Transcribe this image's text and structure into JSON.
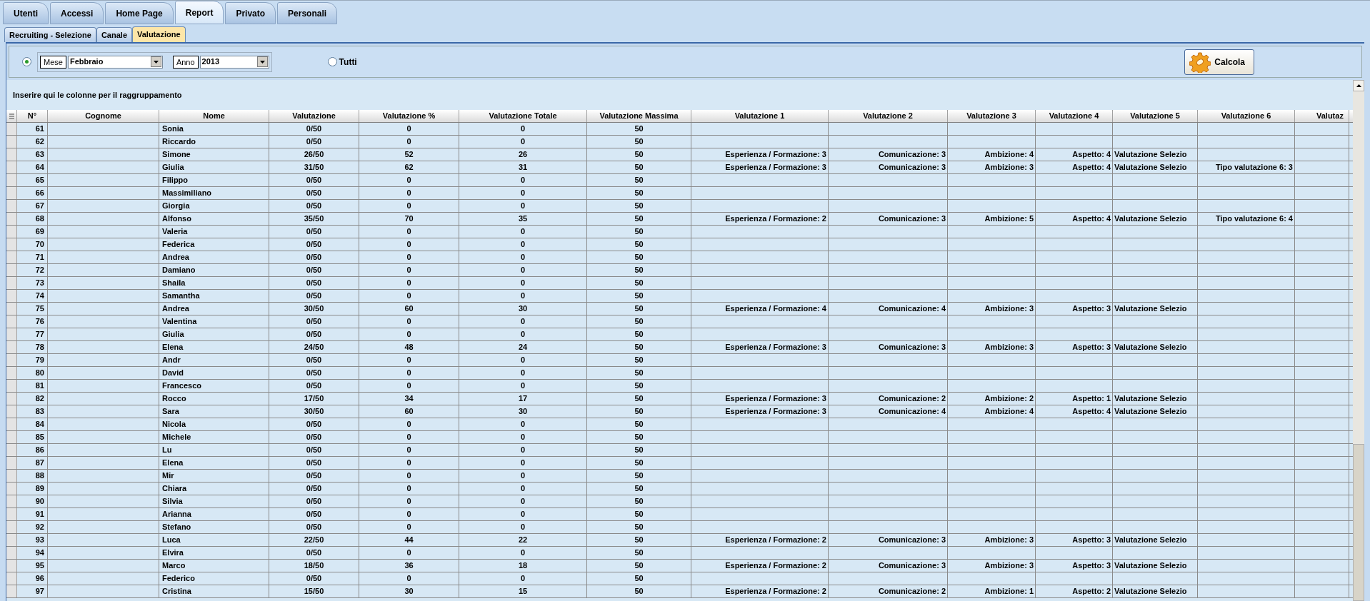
{
  "tabs": [
    {
      "label": "Utenti",
      "selected": false
    },
    {
      "label": "Accessi",
      "selected": false
    },
    {
      "label": "Home Page",
      "selected": false
    },
    {
      "label": "Report",
      "selected": true
    },
    {
      "label": "Privato",
      "selected": false
    },
    {
      "label": "Personali",
      "selected": false
    }
  ],
  "subtabs": [
    {
      "label": "Recruiting - Selezione",
      "selected": false
    },
    {
      "label": "Canale",
      "selected": false
    },
    {
      "label": "Valutazione",
      "selected": true
    }
  ],
  "filter": {
    "month_radio": {
      "selected": true
    },
    "month": {
      "label": "Mese",
      "value": "Febbraio"
    },
    "year": {
      "label": "Anno",
      "value": "2013"
    },
    "all_radio": {
      "label": "Tutti",
      "selected": false
    },
    "calculate_button": "Calcola"
  },
  "group_hint": "Inserire qui le colonne per il raggruppamento",
  "table": {
    "columns": [
      "N°",
      "Cognome",
      "Nome",
      "Valutazione",
      "Valutazione %",
      "Valutazione Totale",
      "Valutazione Massima",
      "Valutazione 1",
      "Valutazione 2",
      "Valutazione 3",
      "Valutazione 4",
      "Valutazione 5",
      "Valutazione 6",
      "Valutaz"
    ],
    "rows": [
      {
        "n": "61",
        "nome": "Sonia",
        "val": "0/50",
        "pct": "0",
        "tot": "0",
        "max": "50"
      },
      {
        "n": "62",
        "nome": "Riccardo",
        "val": "0/50",
        "pct": "0",
        "tot": "0",
        "max": "50"
      },
      {
        "n": "63",
        "nome": "Simone",
        "val": "26/50",
        "pct": "52",
        "tot": "26",
        "max": "50",
        "v1": "Esperienza / Formazione: 3",
        "v2": "Comunicazione: 3",
        "v3": "Ambizione: 4",
        "v4": "Aspetto: 4",
        "v5": "Valutazione Selezio"
      },
      {
        "n": "64",
        "nome": "Giulia",
        "val": "31/50",
        "pct": "62",
        "tot": "31",
        "max": "50",
        "v1": "Esperienza / Formazione: 3",
        "v2": "Comunicazione: 3",
        "v3": "Ambizione: 3",
        "v4": "Aspetto: 4",
        "v5": "Valutazione Selezio",
        "v6": "Tipo valutazione 6: 3"
      },
      {
        "n": "65",
        "nome": "Filippo",
        "val": "0/50",
        "pct": "0",
        "tot": "0",
        "max": "50"
      },
      {
        "n": "66",
        "nome": "Massimiliano",
        "val": "0/50",
        "pct": "0",
        "tot": "0",
        "max": "50"
      },
      {
        "n": "67",
        "nome": "Giorgia",
        "val": "0/50",
        "pct": "0",
        "tot": "0",
        "max": "50"
      },
      {
        "n": "68",
        "nome": "Alfonso",
        "val": "35/50",
        "pct": "70",
        "tot": "35",
        "max": "50",
        "v1": "Esperienza / Formazione: 2",
        "v2": "Comunicazione: 3",
        "v3": "Ambizione: 5",
        "v4": "Aspetto: 4",
        "v5": "Valutazione Selezio",
        "v6": "Tipo valutazione 6: 4"
      },
      {
        "n": "69",
        "nome": "Valeria",
        "val": "0/50",
        "pct": "0",
        "tot": "0",
        "max": "50"
      },
      {
        "n": "70",
        "nome": "Federica",
        "val": "0/50",
        "pct": "0",
        "tot": "0",
        "max": "50"
      },
      {
        "n": "71",
        "nome": "Andrea",
        "val": "0/50",
        "pct": "0",
        "tot": "0",
        "max": "50"
      },
      {
        "n": "72",
        "nome": "Damiano",
        "val": "0/50",
        "pct": "0",
        "tot": "0",
        "max": "50"
      },
      {
        "n": "73",
        "nome": "Shaila",
        "val": "0/50",
        "pct": "0",
        "tot": "0",
        "max": "50"
      },
      {
        "n": "74",
        "nome": "Samantha",
        "val": "0/50",
        "pct": "0",
        "tot": "0",
        "max": "50"
      },
      {
        "n": "75",
        "nome": "Andrea",
        "val": "30/50",
        "pct": "60",
        "tot": "30",
        "max": "50",
        "v1": "Esperienza / Formazione: 4",
        "v2": "Comunicazione: 4",
        "v3": "Ambizione: 3",
        "v4": "Aspetto: 3",
        "v5": "Valutazione Selezio"
      },
      {
        "n": "76",
        "nome": "Valentina",
        "val": "0/50",
        "pct": "0",
        "tot": "0",
        "max": "50"
      },
      {
        "n": "77",
        "nome": "Giulia",
        "val": "0/50",
        "pct": "0",
        "tot": "0",
        "max": "50"
      },
      {
        "n": "78",
        "nome": "Elena",
        "val": "24/50",
        "pct": "48",
        "tot": "24",
        "max": "50",
        "v1": "Esperienza / Formazione: 3",
        "v2": "Comunicazione: 3",
        "v3": "Ambizione: 3",
        "v4": "Aspetto: 3",
        "v5": "Valutazione Selezio"
      },
      {
        "n": "79",
        "nome": "Andr",
        "val": "0/50",
        "pct": "0",
        "tot": "0",
        "max": "50"
      },
      {
        "n": "80",
        "nome": "David",
        "val": "0/50",
        "pct": "0",
        "tot": "0",
        "max": "50"
      },
      {
        "n": "81",
        "nome": "Francesco",
        "val": "0/50",
        "pct": "0",
        "tot": "0",
        "max": "50"
      },
      {
        "n": "82",
        "nome": "Rocco",
        "val": "17/50",
        "pct": "34",
        "tot": "17",
        "max": "50",
        "v1": "Esperienza / Formazione: 3",
        "v2": "Comunicazione: 2",
        "v3": "Ambizione: 2",
        "v4": "Aspetto: 1",
        "v5": "Valutazione Selezio"
      },
      {
        "n": "83",
        "nome": "Sara",
        "val": "30/50",
        "pct": "60",
        "tot": "30",
        "max": "50",
        "v1": "Esperienza / Formazione: 3",
        "v2": "Comunicazione: 4",
        "v3": "Ambizione: 4",
        "v4": "Aspetto: 4",
        "v5": "Valutazione Selezio"
      },
      {
        "n": "84",
        "nome": "Nicola",
        "val": "0/50",
        "pct": "0",
        "tot": "0",
        "max": "50"
      },
      {
        "n": "85",
        "nome": "Michele",
        "val": "0/50",
        "pct": "0",
        "tot": "0",
        "max": "50"
      },
      {
        "n": "86",
        "nome": "Lu",
        "val": "0/50",
        "pct": "0",
        "tot": "0",
        "max": "50"
      },
      {
        "n": "87",
        "nome": "Elena",
        "val": "0/50",
        "pct": "0",
        "tot": "0",
        "max": "50"
      },
      {
        "n": "88",
        "nome": "Mir",
        "val": "0/50",
        "pct": "0",
        "tot": "0",
        "max": "50"
      },
      {
        "n": "89",
        "nome": "Chiara",
        "val": "0/50",
        "pct": "0",
        "tot": "0",
        "max": "50"
      },
      {
        "n": "90",
        "nome": "Silvia",
        "val": "0/50",
        "pct": "0",
        "tot": "0",
        "max": "50"
      },
      {
        "n": "91",
        "nome": "Arianna",
        "val": "0/50",
        "pct": "0",
        "tot": "0",
        "max": "50"
      },
      {
        "n": "92",
        "nome": "Stefano",
        "val": "0/50",
        "pct": "0",
        "tot": "0",
        "max": "50"
      },
      {
        "n": "93",
        "nome": "Luca",
        "val": "22/50",
        "pct": "44",
        "tot": "22",
        "max": "50",
        "v1": "Esperienza / Formazione: 2",
        "v2": "Comunicazione: 3",
        "v3": "Ambizione: 3",
        "v4": "Aspetto: 3",
        "v5": "Valutazione Selezio"
      },
      {
        "n": "94",
        "nome": "Elvira",
        "val": "0/50",
        "pct": "0",
        "tot": "0",
        "max": "50"
      },
      {
        "n": "95",
        "nome": "Marco",
        "val": "18/50",
        "pct": "36",
        "tot": "18",
        "max": "50",
        "v1": "Esperienza / Formazione: 2",
        "v2": "Comunicazione: 3",
        "v3": "Ambizione: 3",
        "v4": "Aspetto: 3",
        "v5": "Valutazione Selezio"
      },
      {
        "n": "96",
        "nome": "Federico",
        "val": "0/50",
        "pct": "0",
        "tot": "0",
        "max": "50"
      },
      {
        "n": "97",
        "nome": "Cristina",
        "val": "15/50",
        "pct": "30",
        "tot": "15",
        "max": "50",
        "v1": "Esperienza / Formazione: 2",
        "v2": "Comunicazione: 2",
        "v3": "Ambizione: 1",
        "v4": "Aspetto: 2",
        "v5": "Valutazione Selezio"
      }
    ]
  }
}
